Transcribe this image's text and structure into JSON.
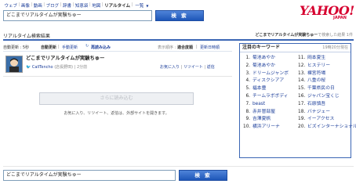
{
  "nav": {
    "items": [
      "ウェブ",
      "画像",
      "動画",
      "ブログ",
      "辞書",
      "知恵袋",
      "地図",
      "リアルタイム",
      "一覧"
    ],
    "dropdown_arrow": "▼"
  },
  "search": {
    "query": "どこまでリアルタイムが実験ちゅー",
    "button": "検 索"
  },
  "logo": {
    "text": "YAHOO!",
    "sub": "JAPAN"
  },
  "header_right": {
    "query": "どこまでリアルタイムが実験ちゅー",
    "suffix": "で検索した結果 1件"
  },
  "section_title": "リアルタイム検索結果",
  "options": {
    "autoupdate_label": "自動更新 : 5秒",
    "autoupdate_value": "自動更新",
    "manual": "手動更新",
    "reload": "再読み込み",
    "display_order_label": "表示順序 :",
    "order_relevance": "適合度順",
    "order_latest": "更新日時順"
  },
  "result": {
    "title": "どこまでリアルタイムが実験ちゅー",
    "user": "CallTencho",
    "place": "(店長野田)",
    "time": "2分前",
    "actions": [
      "お気に入り",
      "リツイート",
      "返信"
    ]
  },
  "more_button": "さらに読み込む",
  "notice": "お気に入り、リツイート、返信は、外部サイトを開きます。",
  "keywords": {
    "title": "注目のキーワード",
    "time": "19時20分現在",
    "left": [
      {
        "num": "1.",
        "label": "菊池あやか"
      },
      {
        "num": "2.",
        "label": "菊池あやか"
      },
      {
        "num": "3.",
        "label": "ドリームジャンボ"
      },
      {
        "num": "4.",
        "label": "ディスクシアア"
      },
      {
        "num": "5.",
        "label": "福本豊"
      },
      {
        "num": "6.",
        "label": "チームラボボディ"
      },
      {
        "num": "7.",
        "label": "beast"
      },
      {
        "num": "8.",
        "label": "赤井冒部屋"
      },
      {
        "num": "9.",
        "label": "吉澤夏帆"
      },
      {
        "num": "10.",
        "label": "横浜アリーナ"
      }
    ],
    "right": [
      {
        "num": "11.",
        "label": "岡本夏生"
      },
      {
        "num": "12.",
        "label": "ヒステリー"
      },
      {
        "num": "13.",
        "label": "裸宮符場"
      },
      {
        "num": "14.",
        "label": "八重の桜"
      },
      {
        "num": "15.",
        "label": "千葉県民の日"
      },
      {
        "num": "16.",
        "label": "ジャパン宝くじ"
      },
      {
        "num": "17.",
        "label": "石原慎吾"
      },
      {
        "num": "18.",
        "label": "バナジェー"
      },
      {
        "num": "19.",
        "label": "イーアクセス"
      },
      {
        "num": "20.",
        "label": "ビズインターナショナル"
      }
    ]
  },
  "bottom_search": {
    "query": "どこまでリアルタイムが実験ちゅー",
    "button": "検 索"
  },
  "colors": {
    "brand_red": "#d6002f",
    "accent_blue": "#3b66b4",
    "link": "#1a3c99"
  }
}
